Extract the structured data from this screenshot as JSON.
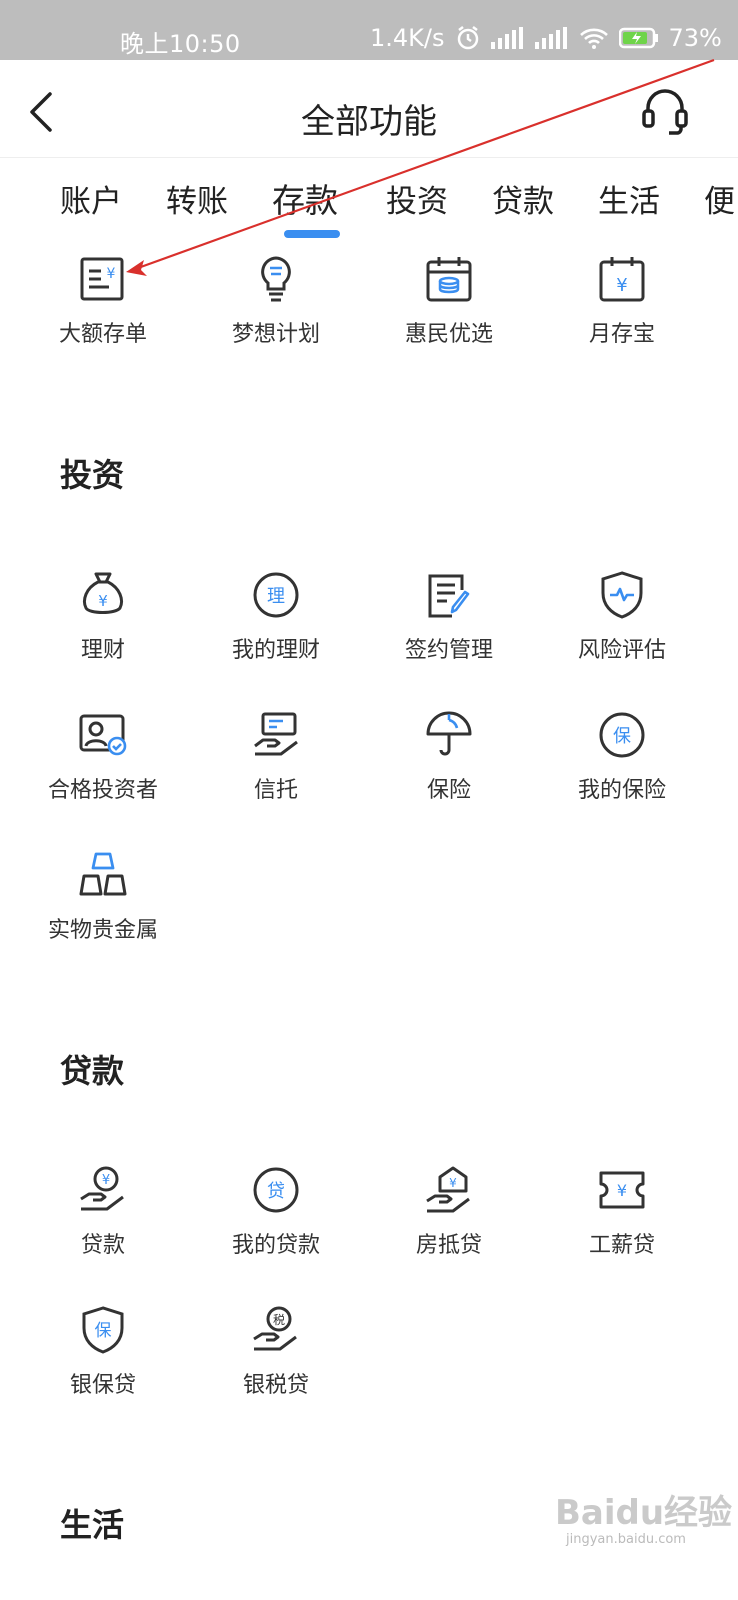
{
  "status_bar": {
    "time": "晚上10:50",
    "speed": "1.4K/s",
    "battery": "73%"
  },
  "header": {
    "title": "全部功能"
  },
  "tabs": [
    {
      "label": "账户"
    },
    {
      "label": "转账"
    },
    {
      "label": "存款"
    },
    {
      "label": "投资"
    },
    {
      "label": "贷款"
    },
    {
      "label": "生活"
    },
    {
      "label": "便"
    }
  ],
  "active_tab": "存款",
  "deposit": {
    "items": [
      {
        "label": "大额存单",
        "icon": "certificate-icon"
      },
      {
        "label": "梦想计划",
        "icon": "lightbulb-icon"
      },
      {
        "label": "惠民优选",
        "icon": "coin-calendar-icon"
      },
      {
        "label": "月存宝",
        "icon": "yuan-calendar-icon"
      }
    ]
  },
  "invest": {
    "title": "投资",
    "items": [
      {
        "label": "理财",
        "icon": "money-bag-icon"
      },
      {
        "label": "我的理财",
        "icon": "li-circle-icon",
        "glyph": "理"
      },
      {
        "label": "签约管理",
        "icon": "document-pen-icon"
      },
      {
        "label": "风险评估",
        "icon": "shield-pulse-icon"
      },
      {
        "label": "合格投资者",
        "icon": "id-card-check-icon"
      },
      {
        "label": "信托",
        "icon": "hand-card-icon"
      },
      {
        "label": "保险",
        "icon": "umbrella-icon"
      },
      {
        "label": "我的保险",
        "icon": "bao-circle-icon",
        "glyph": "保"
      },
      {
        "label": "实物贵金属",
        "icon": "gold-bars-icon"
      }
    ]
  },
  "loan": {
    "title": "贷款",
    "items": [
      {
        "label": "贷款",
        "icon": "hand-coin-icon"
      },
      {
        "label": "我的贷款",
        "icon": "dai-circle-icon",
        "glyph": "贷"
      },
      {
        "label": "房抵贷",
        "icon": "hand-house-icon"
      },
      {
        "label": "工薪贷",
        "icon": "ticket-yuan-icon"
      },
      {
        "label": "银保贷",
        "icon": "bao-shield-icon",
        "glyph": "保"
      },
      {
        "label": "银税贷",
        "icon": "hand-tax-icon",
        "glyph": "税"
      }
    ]
  },
  "life": {
    "title": "生活"
  },
  "watermark": {
    "text": "Baidu经验",
    "sub": "jingyan.baidu.com"
  },
  "colors": {
    "accent": "#3a8ef0",
    "icon_dark": "#333333",
    "annotation": "#d9302c"
  }
}
